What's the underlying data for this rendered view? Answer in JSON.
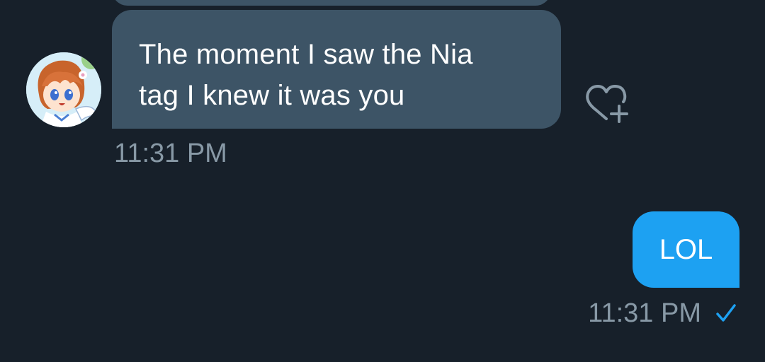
{
  "conversation": {
    "incoming": {
      "text": "The moment I saw the Nia\ntag I knew it was you",
      "time": "11:31 PM",
      "avatar_icon": "anime-character-avatar",
      "reaction_icon": "heart-plus-icon"
    },
    "outgoing": {
      "text": "LOL",
      "time": "11:31 PM",
      "status_icon": "checkmark-icon"
    }
  },
  "colors": {
    "background": "#17202a",
    "incoming_bubble": "#3d5466",
    "outgoing_bubble": "#1da1f2",
    "timestamp": "#8899a6",
    "check": "#1da1f2"
  }
}
